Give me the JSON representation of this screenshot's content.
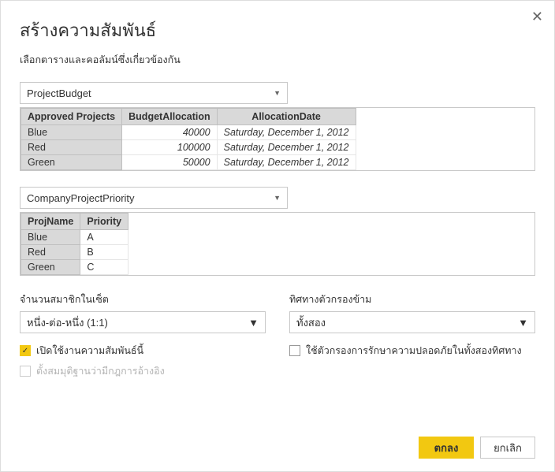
{
  "dialog": {
    "title": "สร้างความสัมพันธ์",
    "subtitle": "เลือกตารางและคอลัมน์ซึ่งเกี่ยวข้องกัน"
  },
  "table1": {
    "selected": "ProjectBudget",
    "headers": [
      "Approved Projects",
      "BudgetAllocation",
      "AllocationDate"
    ],
    "rows": [
      {
        "c0": "Blue",
        "c1": "40000",
        "c2": "Saturday, December 1, 2012"
      },
      {
        "c0": "Red",
        "c1": "100000",
        "c2": "Saturday, December 1, 2012"
      },
      {
        "c0": "Green",
        "c1": "50000",
        "c2": "Saturday, December 1, 2012"
      }
    ]
  },
  "table2": {
    "selected": "CompanyProjectPriority",
    "headers": [
      "ProjName",
      "Priority"
    ],
    "rows": [
      {
        "c0": "Blue",
        "c1": "A"
      },
      {
        "c0": "Red",
        "c1": "B"
      },
      {
        "c0": "Green",
        "c1": "C"
      }
    ]
  },
  "cardinality": {
    "label": "จำนวนสมาชิกในเซ็ต",
    "value": "หนึ่ง-ต่อ-หนึ่ง (1:1)"
  },
  "crossfilter": {
    "label": "ทิศทางตัวกรองข้าม",
    "value": "ทั้งสอง"
  },
  "checks": {
    "active": "เปิดใช้งานความสัมพันธ์นี้",
    "referential": "ตั้งสมมุติฐานว่ามีกฎการอ้างอิง",
    "security": "ใช้ตัวกรองการรักษาความปลอดภัยในทั้งสองทิศทาง"
  },
  "buttons": {
    "ok": "ตกลง",
    "cancel": "ยกเลิก"
  }
}
